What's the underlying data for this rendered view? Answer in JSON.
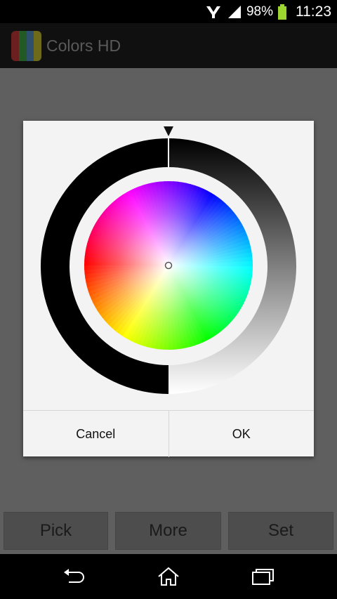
{
  "status_bar": {
    "battery": "98%",
    "time": "11:23"
  },
  "app": {
    "title": "Colors HD"
  },
  "dialog": {
    "cancel_label": "Cancel",
    "ok_label": "OK"
  },
  "bottom_buttons": {
    "pick": "Pick",
    "more": "More",
    "set": "Set"
  },
  "colors": {
    "dialog_bg": "#f3f3f3",
    "overlay": "#5f5f5f",
    "selected": "#000000"
  }
}
